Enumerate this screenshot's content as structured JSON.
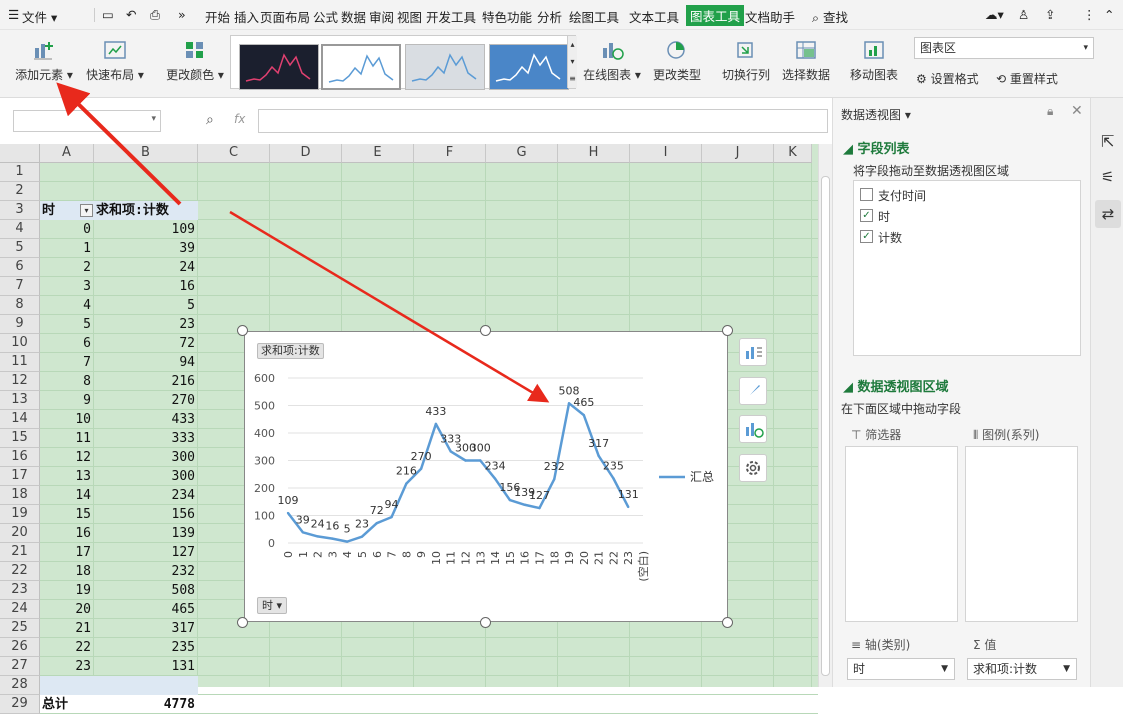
{
  "menubar": {
    "file_label": "文件",
    "tabs": [
      "开始",
      "插入",
      "页面布局",
      "公式",
      "数据",
      "审阅",
      "视图",
      "开发工具",
      "特色功能",
      "分析",
      "绘图工具",
      "文本工具",
      "图表工具",
      "文档助手"
    ],
    "search_label": "查找"
  },
  "ribbon": {
    "add_element": "添加元素",
    "quick_layout": "快速布局",
    "change_color": "更改颜色",
    "online_chart": "在线图表",
    "change_type": "更改类型",
    "switch_rowcol": "切换行列",
    "select_data": "选择数据",
    "move_chart": "移动图表",
    "area_select": "图表区",
    "set_format": "设置格式",
    "reset_style": "重置样式"
  },
  "formula": {
    "fx": "fx",
    "namebox": "",
    "content": ""
  },
  "sheet": {
    "columns": [
      "A",
      "B",
      "C",
      "D",
      "E",
      "F",
      "G",
      "H",
      "I",
      "J",
      "K"
    ],
    "header_left": "时",
    "header_right": "求和项:计数",
    "hours": [
      "0",
      "1",
      "2",
      "3",
      "4",
      "5",
      "6",
      "7",
      "8",
      "9",
      "10",
      "11",
      "12",
      "13",
      "14",
      "15",
      "16",
      "17",
      "18",
      "19",
      "20",
      "21",
      "22",
      "23"
    ],
    "values": [
      "109",
      "39",
      "24",
      "16",
      "5",
      "23",
      "72",
      "94",
      "216",
      "270",
      "433",
      "333",
      "300",
      "300",
      "234",
      "156",
      "139",
      "127",
      "232",
      "508",
      "465",
      "317",
      "235",
      "131"
    ],
    "blank_label": "(空白)",
    "total_label": "总计",
    "total_value": "4778"
  },
  "chart_data": {
    "type": "line",
    "title": "求和项:计数",
    "categories": [
      "0",
      "1",
      "2",
      "3",
      "4",
      "5",
      "6",
      "7",
      "8",
      "9",
      "10",
      "11",
      "12",
      "13",
      "14",
      "15",
      "16",
      "17",
      "18",
      "19",
      "20",
      "21",
      "22",
      "23",
      "(空白)"
    ],
    "series": [
      {
        "name": "汇总",
        "values": [
          109,
          39,
          24,
          16,
          5,
          23,
          72,
          94,
          216,
          270,
          433,
          333,
          300,
          300,
          234,
          156,
          139,
          127,
          232,
          508,
          465,
          317,
          235,
          131,
          null
        ],
        "color": "#5b9bd5"
      }
    ],
    "ylim": [
      0,
      600
    ],
    "yticks": [
      0,
      100,
      200,
      300,
      400,
      500,
      600
    ],
    "legend_position": "right",
    "filter_button": "时"
  },
  "panel": {
    "title": "数据透视图",
    "field_list": "字段列表",
    "drag_hint": "将字段拖动至数据透视图区域",
    "fields": [
      {
        "label": "支付时间",
        "checked": false
      },
      {
        "label": "时",
        "checked": true
      },
      {
        "label": "计数",
        "checked": true
      }
    ],
    "areas_title": "数据透视图区域",
    "areas_hint": "在下面区域中拖动字段",
    "filter_label": "筛选器",
    "legend_label": "图例(系列)",
    "axis_label": "轴(类别)",
    "values_label": "值",
    "axis_value": "时",
    "values_value": "求和项:计数"
  },
  "colors": {
    "accent": "#21a04a",
    "grid_bg": "#cfe7cf",
    "line": "#5b9bd5",
    "arrow": "#e8291c"
  }
}
